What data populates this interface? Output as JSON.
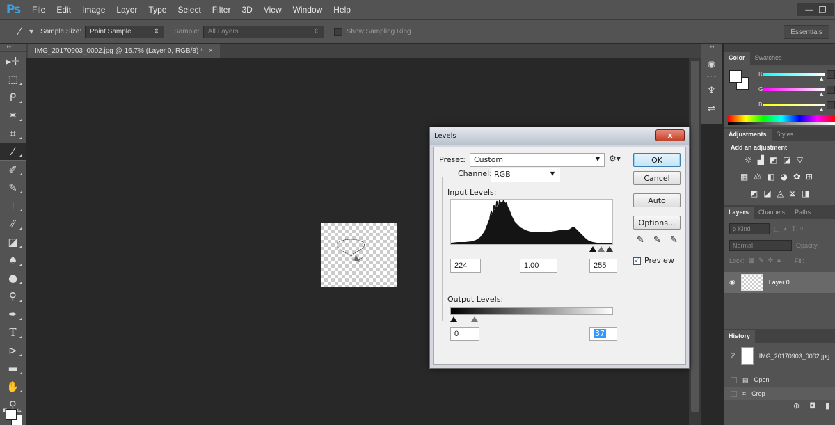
{
  "app": {
    "logo": "Ps"
  },
  "menubar": {
    "items": [
      "File",
      "Edit",
      "Image",
      "Layer",
      "Type",
      "Select",
      "Filter",
      "3D",
      "View",
      "Window",
      "Help"
    ]
  },
  "options": {
    "sample_size_label": "Sample Size:",
    "sample_size_value": "Point Sample",
    "sample_label": "Sample:",
    "sample_value": "All Layers",
    "show_ring_label": "Show Sampling Ring",
    "workspace": "Essentials"
  },
  "document": {
    "tab_title": "IMG_20170903_0002.jpg @ 16.7% (Layer 0, RGB/8) *",
    "tab_close": "×"
  },
  "panels": {
    "color_tabs": [
      "Color",
      "Swatches"
    ],
    "color_sliders": [
      "R",
      "G",
      "B"
    ],
    "adjust_tabs": [
      "Adjustments",
      "Styles"
    ],
    "adjust_title": "Add an adjustment",
    "layers_tabs": [
      "Layers",
      "Channels",
      "Paths"
    ],
    "kind_label": "ρ Kind",
    "blend_mode": "Normal",
    "opacity_label": "Opacity:",
    "lock_label": "Lock:",
    "fill_label": "Fill:",
    "layer_name": "Layer 0",
    "history_tab": "History",
    "history_snapshot": "IMG_20170903_0002.jpg",
    "history_items": [
      "Open",
      "Crop"
    ]
  },
  "levels": {
    "title": "Levels",
    "close": "x",
    "preset_label": "Preset:",
    "preset_value": "Custom",
    "channel_label": "Channel:",
    "channel_value": "RGB",
    "input_label": "Input Levels:",
    "input_black": "224",
    "input_gamma": "1.00",
    "input_white": "255",
    "output_label": "Output Levels:",
    "output_black": "0",
    "output_white": "37",
    "ok": "OK",
    "cancel": "Cancel",
    "auto": "Auto",
    "options": "Options...",
    "preview_label": "Preview",
    "preview_checked": "✓"
  }
}
